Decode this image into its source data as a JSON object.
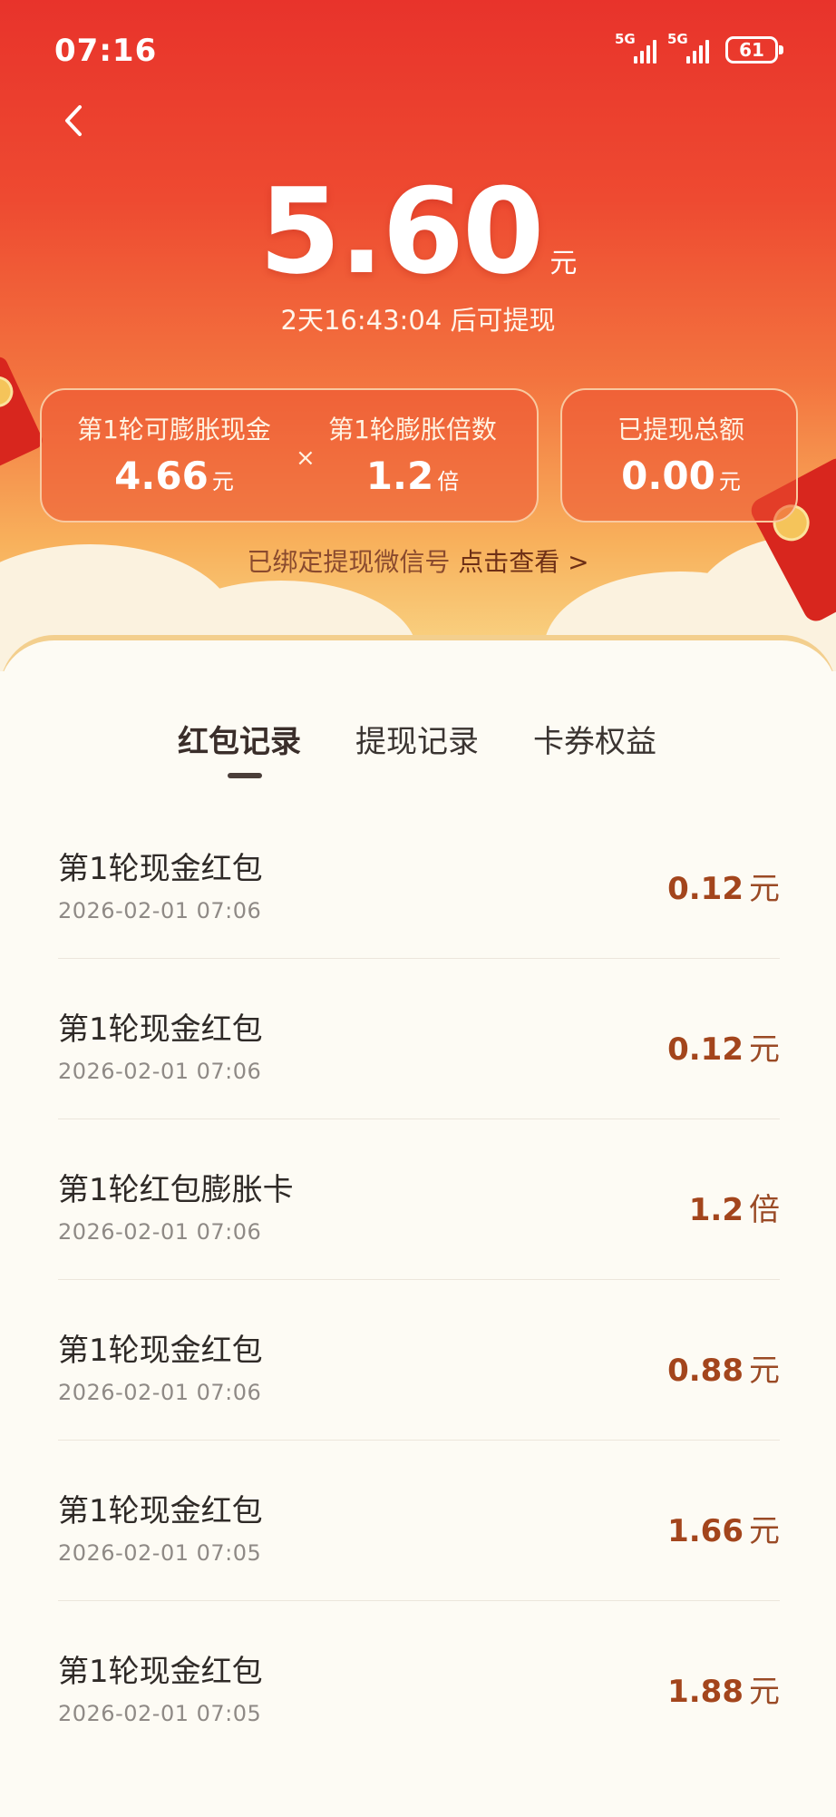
{
  "status_bar": {
    "time": "07:16",
    "signal_1": "5G",
    "signal_2": "5G",
    "battery": "61"
  },
  "balance": {
    "amount": "5.60",
    "unit": "元",
    "countdown": "2天16:43:04 后可提现"
  },
  "stats": {
    "inflatable_cash_label": "第1轮可膨胀现金",
    "inflatable_cash_value": "4.66",
    "inflatable_cash_unit": "元",
    "operator": "×",
    "multiplier_label": "第1轮膨胀倍数",
    "multiplier_value": "1.2",
    "multiplier_unit": "倍",
    "withdrawn_label": "已提现总额",
    "withdrawn_value": "0.00",
    "withdrawn_unit": "元"
  },
  "wechat_bind": {
    "text": "已绑定提现微信号",
    "link": "点击查看 >"
  },
  "tabs": [
    {
      "label": "红包记录",
      "active": true
    },
    {
      "label": "提现记录",
      "active": false
    },
    {
      "label": "卡券权益",
      "active": false
    }
  ],
  "records": [
    {
      "title": "第1轮现金红包",
      "date": "2026-02-01 07:06",
      "amount": "0.12",
      "unit": "元"
    },
    {
      "title": "第1轮现金红包",
      "date": "2026-02-01 07:06",
      "amount": "0.12",
      "unit": "元"
    },
    {
      "title": "第1轮红包膨胀卡",
      "date": "2026-02-01 07:06",
      "amount": "1.2",
      "unit": "倍"
    },
    {
      "title": "第1轮现金红包",
      "date": "2026-02-01 07:06",
      "amount": "0.88",
      "unit": "元"
    },
    {
      "title": "第1轮现金红包",
      "date": "2026-02-01 07:05",
      "amount": "1.66",
      "unit": "元"
    },
    {
      "title": "第1轮现金红包",
      "date": "2026-02-01 07:05",
      "amount": "1.88",
      "unit": "元"
    }
  ],
  "colors": {
    "hero_top": "#e8332b",
    "hero_bottom": "#f9d98a",
    "amount_accent": "#a3451c"
  },
  "icons": {
    "back": "chevron-left-icon"
  }
}
